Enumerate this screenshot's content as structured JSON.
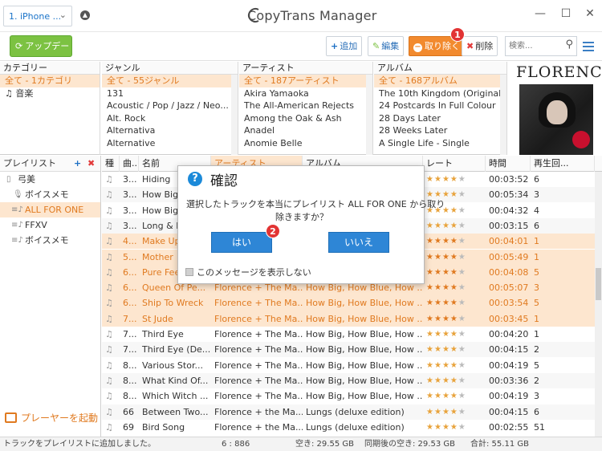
{
  "device": {
    "name": "1. iPhone ...",
    "chevron": "⌄"
  },
  "app": {
    "title": "CopyTrans Manager"
  },
  "window": {
    "minimize": "—",
    "maximize": "☐",
    "close": "✕"
  },
  "toolbar": {
    "update": "アップデート",
    "add": "追加",
    "edit": "編集",
    "remove": "取り除く",
    "delete": "削除",
    "search_placeholder": "検索..."
  },
  "callouts": {
    "one": "1",
    "two": "2"
  },
  "filters": {
    "category": {
      "header": "カテゴリー",
      "items": [
        "全て - 1カテゴリ",
        "音楽"
      ]
    },
    "genre": {
      "header": "ジャンル",
      "items": [
        "全て - 55ジャンル",
        "131",
        "Acoustic / Pop / Jazz / Neo...",
        "Alt. Rock",
        "Alternativa",
        "Alternative"
      ]
    },
    "artist": {
      "header": "アーティスト",
      "items": [
        "全て - 187アーティスト",
        "Akira Yamaoka",
        "The All-American Rejects",
        "Among the Oak & Ash",
        "Anadel",
        "Anomie Belle"
      ]
    },
    "album": {
      "header": "アルバム",
      "items": [
        "全て - 168アルバム",
        "The 10th Kingdom (Original...",
        "24 Postcards In Full Colour",
        "28 Days Later",
        "28 Weeks Later",
        "A Single Life - Single"
      ]
    }
  },
  "artwork": {
    "band": "FLORENCE"
  },
  "playlists": {
    "header": "プレイリスト",
    "add": "+",
    "remove": "✖",
    "items": [
      "弓美",
      "ボイスメモ",
      "ALL FOR ONE",
      "FFXV",
      "ボイスメモ"
    ],
    "player_button": "プレーヤーを起動"
  },
  "tracks": {
    "columns": [
      "種",
      "曲...",
      "名前",
      "アーティスト",
      "アルバム",
      "レート",
      "時間",
      "再生回..."
    ],
    "rows": [
      {
        "no": "3...",
        "name": "Hiding",
        "artist": "",
        "album": "",
        "rating": 4,
        "time": "00:03:52",
        "plays": "6",
        "sel": false
      },
      {
        "no": "3...",
        "name": "How Big",
        "artist": "",
        "album": "",
        "rating": 4,
        "time": "00:05:34",
        "plays": "3",
        "sel": false
      },
      {
        "no": "3...",
        "name": "How Big",
        "artist": "",
        "album": "",
        "rating": 4,
        "time": "00:04:32",
        "plays": "4",
        "sel": false
      },
      {
        "no": "3...",
        "name": "Long & L",
        "artist": "",
        "album": "",
        "rating": 4,
        "time": "00:03:15",
        "plays": "6",
        "sel": false
      },
      {
        "no": "4...",
        "name": "Make Up",
        "artist": "",
        "album": "",
        "rating": 4,
        "time": "00:04:01",
        "plays": "1",
        "sel": true
      },
      {
        "no": "5...",
        "name": "Mother",
        "artist": "",
        "album": "",
        "rating": 4,
        "time": "00:05:49",
        "plays": "1",
        "sel": true
      },
      {
        "no": "6...",
        "name": "Pure Fee",
        "artist": "",
        "album": "",
        "rating": 4,
        "time": "00:04:08",
        "plays": "5",
        "sel": true
      },
      {
        "no": "6...",
        "name": "Queen Of Pe...",
        "artist": "Florence + The Ma...",
        "album": "How Big, How Blue, How ...",
        "rating": 4,
        "time": "00:05:07",
        "plays": "3",
        "sel": true
      },
      {
        "no": "6...",
        "name": "Ship To Wreck",
        "artist": "Florence + The Ma...",
        "album": "How Big, How Blue, How ...",
        "rating": 4,
        "time": "00:03:54",
        "plays": "5",
        "sel": true
      },
      {
        "no": "7...",
        "name": "St Jude",
        "artist": "Florence + The Ma...",
        "album": "How Big, How Blue, How ...",
        "rating": 4,
        "time": "00:03:45",
        "plays": "1",
        "sel": true
      },
      {
        "no": "7...",
        "name": "Third Eye",
        "artist": "Florence + The Ma...",
        "album": "How Big, How Blue, How ...",
        "rating": 4,
        "time": "00:04:20",
        "plays": "1",
        "sel": false
      },
      {
        "no": "7...",
        "name": "Third Eye (De...",
        "artist": "Florence + The Ma...",
        "album": "How Big, How Blue, How ...",
        "rating": 4,
        "time": "00:04:15",
        "plays": "2",
        "sel": false
      },
      {
        "no": "8...",
        "name": "Various Stor...",
        "artist": "Florence + The Ma...",
        "album": "How Big, How Blue, How ...",
        "rating": 4,
        "time": "00:04:19",
        "plays": "5",
        "sel": false
      },
      {
        "no": "8...",
        "name": "What Kind Of...",
        "artist": "Florence + The Ma...",
        "album": "How Big, How Blue, How ...",
        "rating": 4,
        "time": "00:03:36",
        "plays": "2",
        "sel": false
      },
      {
        "no": "8...",
        "name": "Which Witch ...",
        "artist": "Florence + The Ma...",
        "album": "How Big, How Blue, How ...",
        "rating": 4,
        "time": "00:04:19",
        "plays": "3",
        "sel": false
      },
      {
        "no": "66",
        "name": "Between Two...",
        "artist": "Florence + the Ma...",
        "album": "Lungs (deluxe edition)",
        "rating": 4,
        "time": "00:04:15",
        "plays": "6",
        "sel": false
      },
      {
        "no": "69",
        "name": "Bird Song",
        "artist": "Florence + the Ma...",
        "album": "Lungs (deluxe edition)",
        "rating": 4,
        "time": "00:02:55",
        "plays": "51",
        "sel": false
      }
    ]
  },
  "dialog": {
    "title": "確認",
    "message_line1": "選択したトラックを本当にプレイリスト  ALL FOR ONE から取り",
    "message_line2": "除きますか？",
    "yes": "はい",
    "no": "いいえ",
    "dont_show": "このメッセージを表示しない"
  },
  "status": {
    "left": "トラックをプレイリストに追加しました。",
    "count": "6 : 886",
    "free": "空き: 29.55 GB",
    "free_after": "同期後の空き: 29.53 GB",
    "total": "合計: 55.11 GB"
  },
  "colors": {
    "accent": "#f28a2e",
    "selection": "#fde6cf",
    "update": "#7cc242",
    "primary": "#2e86d6"
  }
}
